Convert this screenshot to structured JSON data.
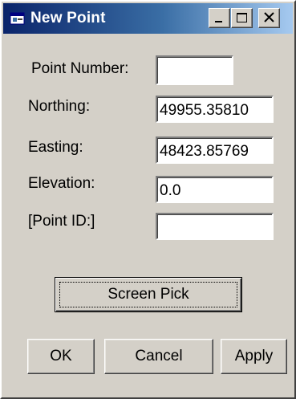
{
  "window": {
    "title": "New Point",
    "icon": "app-window-icon",
    "controls": {
      "minimize_icon": "minimize-icon",
      "maximize_icon": "maximize-icon",
      "close_icon": "close-icon"
    }
  },
  "form": {
    "point_number": {
      "label": "Point Number:",
      "value": ""
    },
    "northing": {
      "label": "Northing:",
      "value": "49955.35810"
    },
    "easting": {
      "label": "Easting:",
      "value": "48423.85769"
    },
    "elevation": {
      "label": "Elevation:",
      "value": "0.0"
    },
    "point_id": {
      "label": "[Point ID:]",
      "value": ""
    }
  },
  "buttons": {
    "screen_pick": "Screen Pick",
    "ok": "OK",
    "cancel": "Cancel",
    "apply": "Apply"
  },
  "colors": {
    "title_gradient_start": "#0a246a",
    "title_gradient_end": "#a6caf0",
    "face": "#d4d0c8"
  }
}
